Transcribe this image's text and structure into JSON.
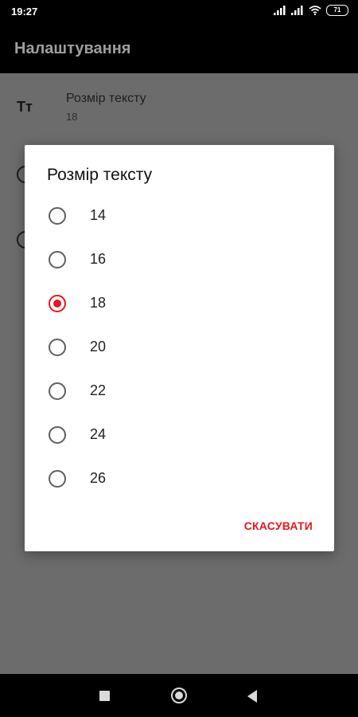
{
  "status_bar": {
    "time": "19:27",
    "battery": "71",
    "icons": [
      "signal-icon",
      "signal-icon",
      "wifi-icon",
      "battery-icon"
    ]
  },
  "app_bar": {
    "title": "Налаштування"
  },
  "background_pref": {
    "icon_text": "Тт",
    "title": "Розмір тексту",
    "summary": "18"
  },
  "dialog": {
    "title": "Розмір тексту",
    "options": [
      {
        "label": "14",
        "selected": false
      },
      {
        "label": "16",
        "selected": false
      },
      {
        "label": "18",
        "selected": true
      },
      {
        "label": "20",
        "selected": false
      },
      {
        "label": "22",
        "selected": false
      },
      {
        "label": "24",
        "selected": false
      },
      {
        "label": "26",
        "selected": false
      }
    ],
    "cancel_label": "СКАСУВАТИ"
  },
  "colors": {
    "accent": "#e8161d",
    "scrim": "#6c6c6c",
    "bar": "#000000"
  },
  "nav_bar": {
    "icons": [
      "recents-icon",
      "home-icon",
      "back-icon"
    ]
  }
}
